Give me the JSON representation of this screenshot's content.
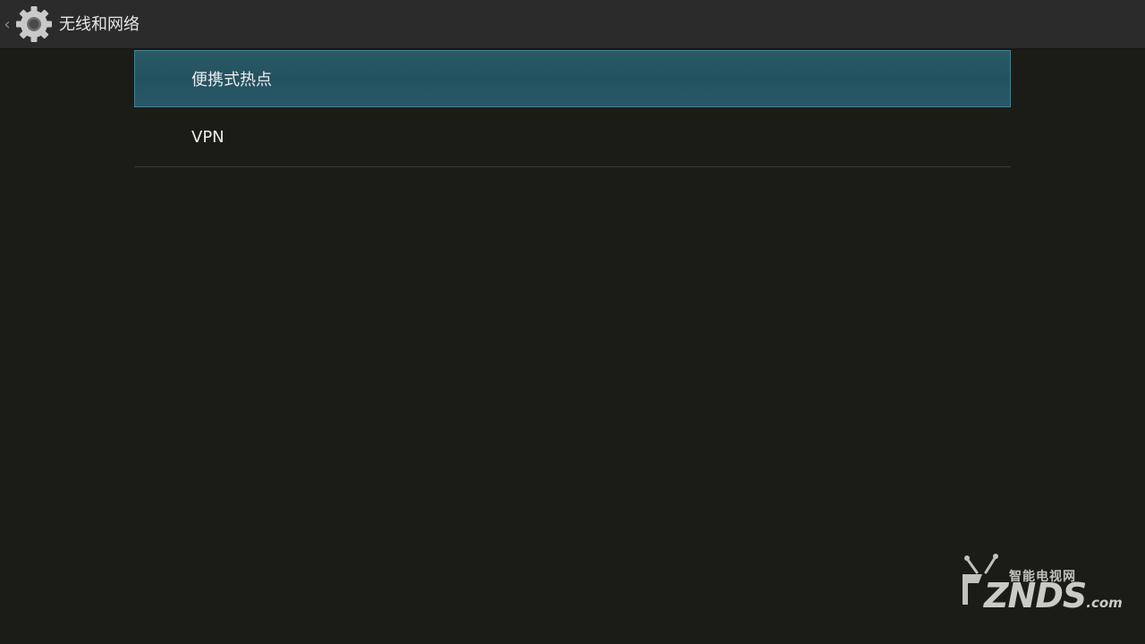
{
  "action_bar": {
    "title": "无线和网络",
    "up_icon": "chevron-left-icon",
    "app_icon": "gear-icon"
  },
  "preferences": [
    {
      "label": "便携式热点",
      "selected": true
    },
    {
      "label": "VPN",
      "selected": false
    }
  ],
  "watermark": {
    "cn_text": "智能电视网",
    "logo_text": "ZNDS",
    "logo_suffix": ".com"
  },
  "colors": {
    "background": "#1c1c16",
    "action_bar": "#2b2b2b",
    "selected_item": "#245260",
    "selected_border": "#3f8394",
    "text": "#ececec"
  }
}
